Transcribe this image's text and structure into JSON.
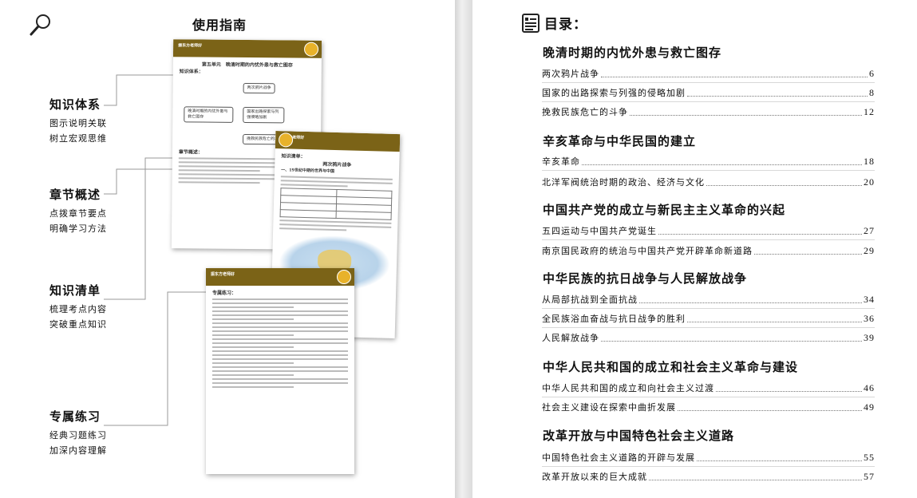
{
  "guide": {
    "title": "使用指南",
    "sections": [
      {
        "title": "知识体系",
        "desc1": "图示说明关联",
        "desc2": "树立宏观思维"
      },
      {
        "title": "章节概述",
        "desc1": "点拨章节要点",
        "desc2": "明确学习方法"
      },
      {
        "title": "知识清单",
        "desc1": "梳理考点内容",
        "desc2": "突破重点知识"
      },
      {
        "title": "专属练习",
        "desc1": "经典习题练习",
        "desc2": "加深内容理解"
      }
    ],
    "thumb1": {
      "brand": "振东方老师好",
      "unit_title": "第五单元　晚清时期的内忧外患与救亡图存",
      "tree_label": "知识体系：",
      "center_node": "晚清时期的内忧外患与救亡图存",
      "branch_1": "两次鸦片战争",
      "branch_2": "国家出路探索与列强侵略加剧",
      "branch_3": "挽救民族危亡的斗争",
      "overview_label": "章节概述："
    },
    "thumb2": {
      "brand": "振东方老师好",
      "list_label": "知识清单：",
      "lesson_title": "两次鸦片战争",
      "sub_1": "一、19世纪中期的世界与中国"
    },
    "thumb3": {
      "brand": "振东方老师好",
      "practice_label": "专属练习："
    }
  },
  "toc": {
    "title": "目录：",
    "chapters": [
      {
        "title": "晚清时期的内忧外患与救亡图存",
        "items": [
          {
            "label": "两次鸦片战争",
            "page": "6"
          },
          {
            "label": "国家的出路探索与列强的侵略加剧",
            "page": "8"
          },
          {
            "label": "挽救民族危亡的斗争",
            "page": "12"
          }
        ]
      },
      {
        "title": "辛亥革命与中华民国的建立",
        "items": [
          {
            "label": "辛亥革命",
            "page": "18"
          },
          {
            "label": "北洋军阀统治时期的政治、经济与文化",
            "page": "20"
          }
        ]
      },
      {
        "title": "中国共产党的成立与新民主主义革命的兴起",
        "items": [
          {
            "label": "五四运动与中国共产党诞生",
            "page": "27"
          },
          {
            "label": "南京国民政府的统治与中国共产党开辟革命新道路",
            "page": "29"
          }
        ]
      },
      {
        "title": "中华民族的抗日战争与人民解放战争",
        "items": [
          {
            "label": "从局部抗战到全面抗战",
            "page": "34"
          },
          {
            "label": "全民族浴血奋战与抗日战争的胜利",
            "page": "36"
          },
          {
            "label": "人民解放战争",
            "page": "39"
          }
        ]
      },
      {
        "title": "中华人民共和国的成立和社会主义革命与建设",
        "items": [
          {
            "label": "中华人民共和国的成立和向社会主义过渡",
            "page": "46"
          },
          {
            "label": "社会主义建设在探索中曲折发展",
            "page": "49"
          }
        ]
      },
      {
        "title": "改革开放与中国特色社会主义道路",
        "items": [
          {
            "label": "中国特色社会主义道路的开辟与发展",
            "page": "55"
          },
          {
            "label": "改革开放以来的巨大成就",
            "page": "57"
          }
        ]
      }
    ]
  },
  "colors": {
    "brand_band": "#7b6317",
    "mascot": "#e8b22a"
  },
  "icons": {
    "guide": "magnifier-icon",
    "toc": "book-list-icon"
  }
}
